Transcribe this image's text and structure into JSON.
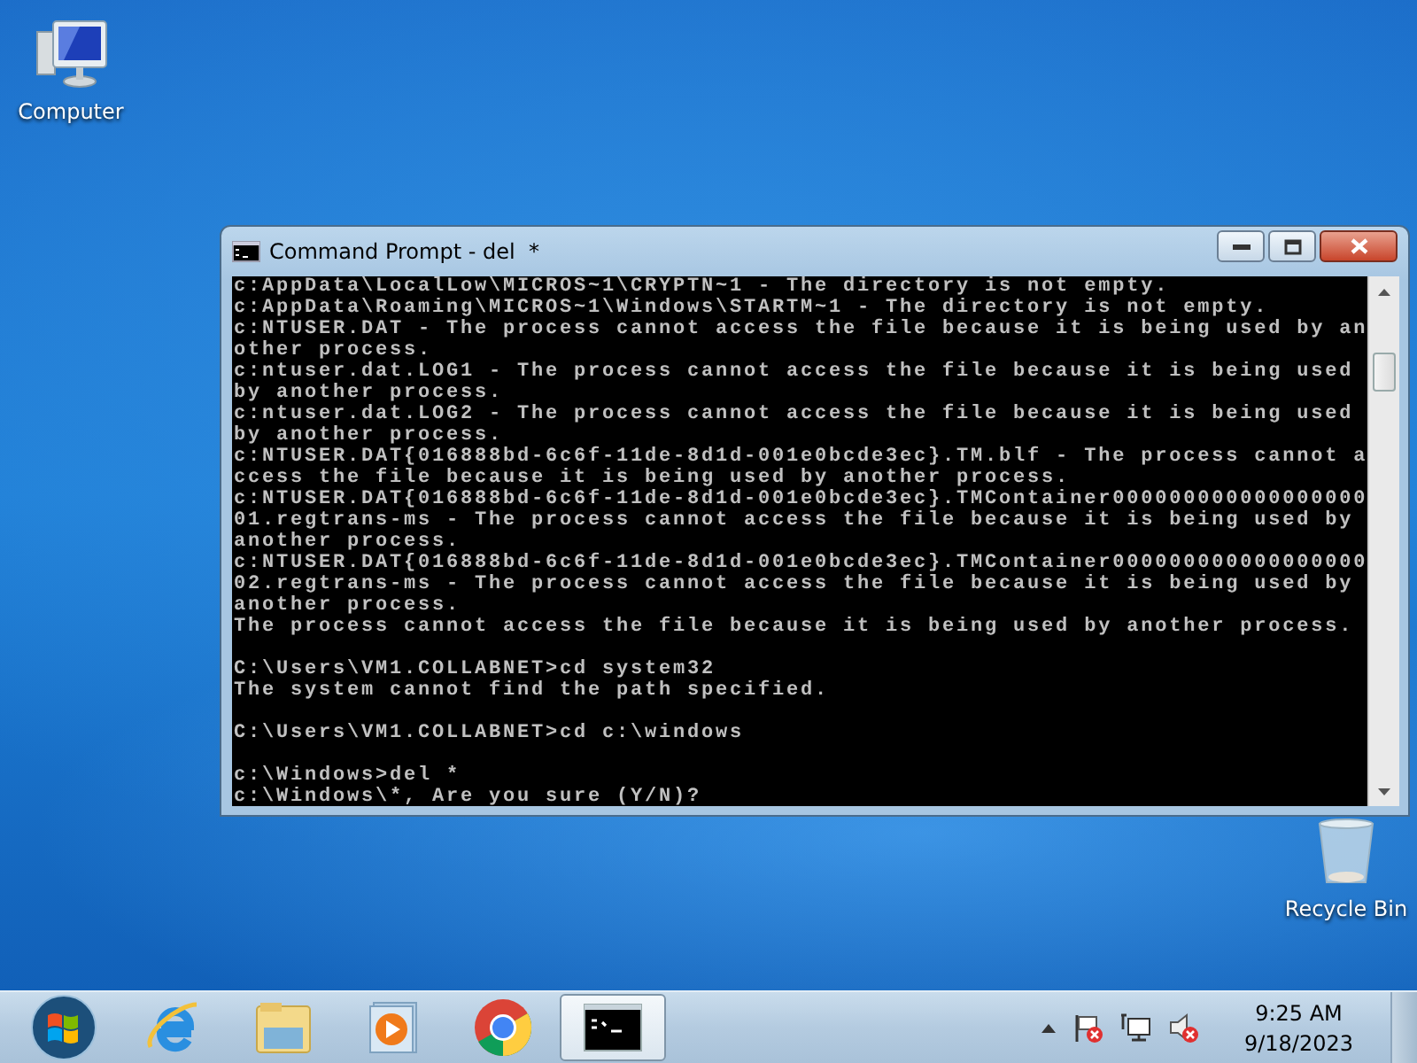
{
  "desktop_icons": [
    {
      "kind": "computer",
      "label": "Computer"
    },
    {
      "kind": "recycle",
      "label": "Recycle Bin"
    }
  ],
  "window": {
    "title": "Command Prompt - del  *",
    "console_blocks": [
      [
        "c:AppData\\LocalLow\\MICROS~1\\CRYPTN~1 - The directory is not empty.",
        "c:AppData\\Roaming\\MICROS~1\\Windows\\STARTM~1 - The directory is not empty.",
        "c:NTUSER.DAT - The process cannot access the file because it is being used by an",
        "other process.",
        "c:ntuser.dat.LOG1 - The process cannot access the file because it is being used",
        "by another process.",
        "c:ntuser.dat.LOG2 - The process cannot access the file because it is being used",
        "by another process.",
        "c:NTUSER.DAT{016888bd-6c6f-11de-8d1d-001e0bcde3ec}.TM.blf - The process cannot a",
        "ccess the file because it is being used by another process.",
        "c:NTUSER.DAT{016888bd-6c6f-11de-8d1d-001e0bcde3ec}.TMContainer000000000000000000",
        "01.regtrans-ms - The process cannot access the file because it is being used by",
        "another process.",
        "c:NTUSER.DAT{016888bd-6c6f-11de-8d1d-001e0bcde3ec}.TMContainer000000000000000000",
        "02.regtrans-ms - The process cannot access the file because it is being used by",
        "another process.",
        "The process cannot access the file because it is being used by another process."
      ],
      [
        "C:\\Users\\VM1.COLLABNET>cd system32",
        "The system cannot find the path specified."
      ],
      [
        "C:\\Users\\VM1.COLLABNET>cd c:\\windows"
      ],
      [
        "c:\\Windows>del *",
        "c:\\Windows\\*, Are you sure (Y/N)?"
      ]
    ]
  },
  "taskbar": {
    "apps": [
      {
        "kind": "start",
        "selected": false
      },
      {
        "kind": "browser",
        "selected": false
      },
      {
        "kind": "folder",
        "selected": false
      },
      {
        "kind": "media",
        "selected": false
      },
      {
        "kind": "chrome",
        "selected": false
      },
      {
        "kind": "cmd",
        "selected": true
      }
    ],
    "clock_time": "9:25 AM",
    "clock_date": "9/18/2023"
  }
}
